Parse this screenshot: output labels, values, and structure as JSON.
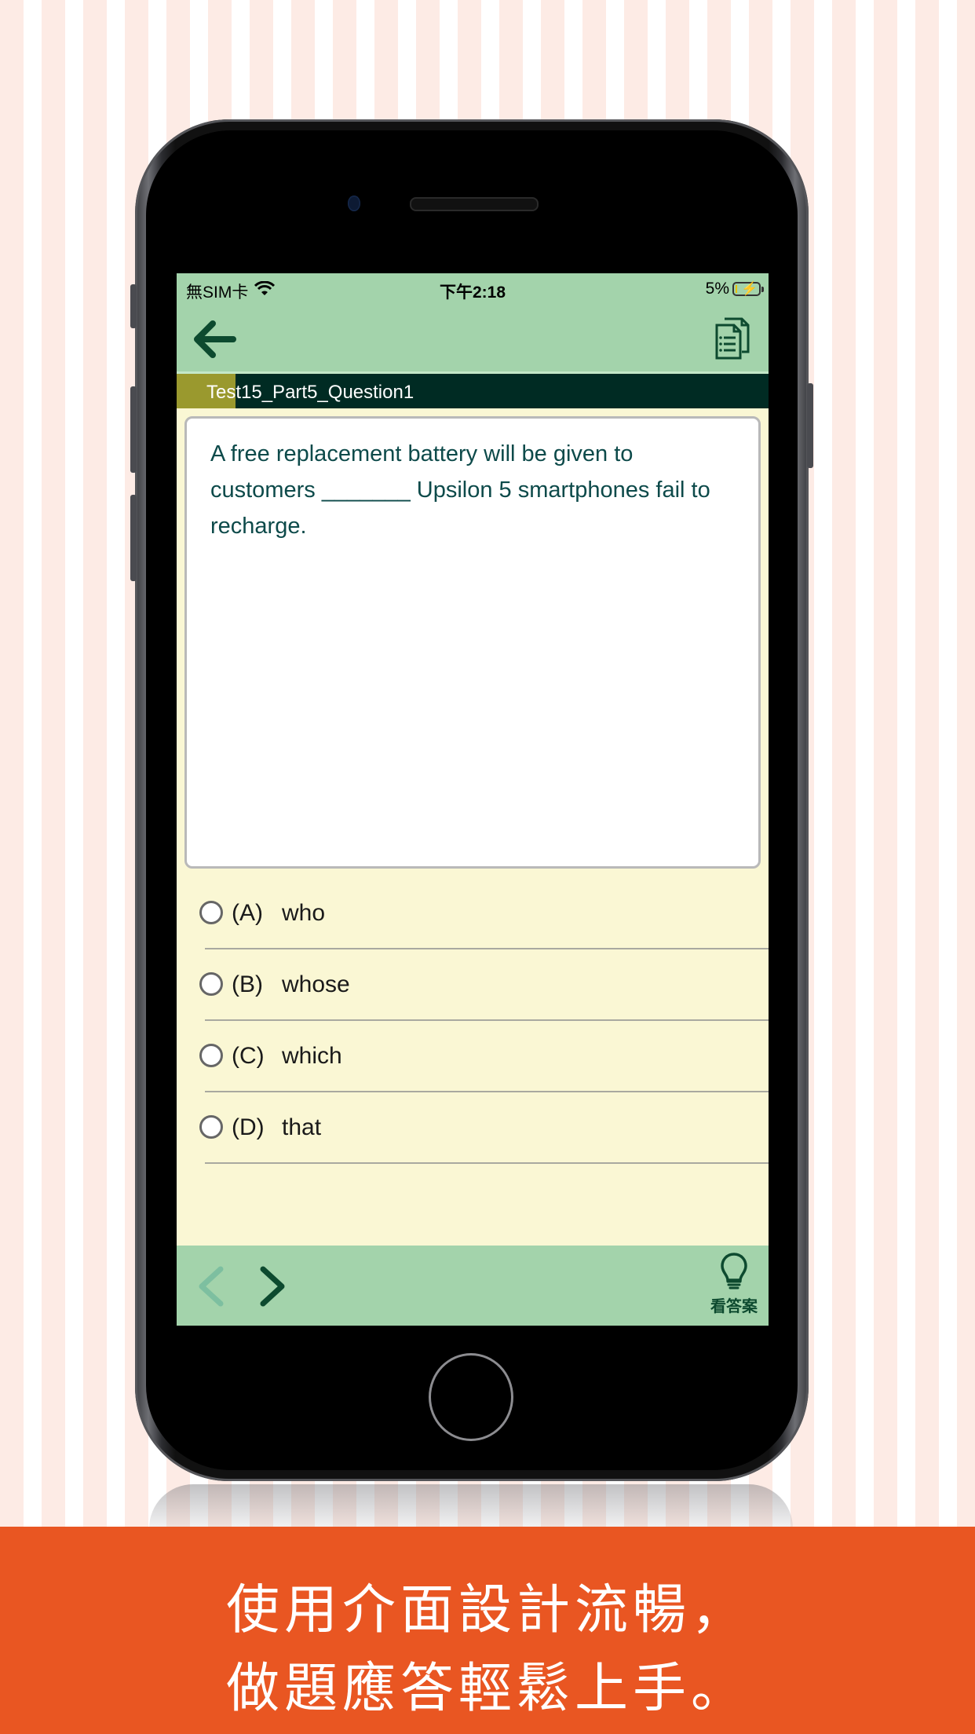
{
  "status_bar": {
    "carrier": "無SIM卡",
    "time": "下午2:18",
    "battery_percent": "5%",
    "battery_level": 0.05,
    "charging": true
  },
  "nav": {
    "back_icon": "arrow-left-icon",
    "menu_icon": "document-list-icon"
  },
  "question": {
    "title": "Test15_Part5_Question1",
    "progress_fraction": 0.1,
    "text": "A free replacement battery will be given to customers _______ Upsilon 5 smartphones fail to recharge."
  },
  "options": [
    {
      "letter": "(A)",
      "text": "who",
      "selected": false
    },
    {
      "letter": "(B)",
      "text": "whose",
      "selected": false
    },
    {
      "letter": "(C)",
      "text": "which",
      "selected": false
    },
    {
      "letter": "(D)",
      "text": "that",
      "selected": false
    }
  ],
  "bottom_bar": {
    "prev_enabled": false,
    "next_enabled": true,
    "answer_label": "看答案"
  },
  "banner": {
    "line1": "使用介面設計流暢，",
    "line2": "做題應答輕鬆上手。"
  },
  "colors": {
    "bar_green": "#a3d3ab",
    "title_dark": "#002b23",
    "progress_olive": "#9a992e",
    "options_bg": "#faf7d4",
    "icon_green": "#0d4a2f",
    "banner_orange": "#e95622"
  }
}
